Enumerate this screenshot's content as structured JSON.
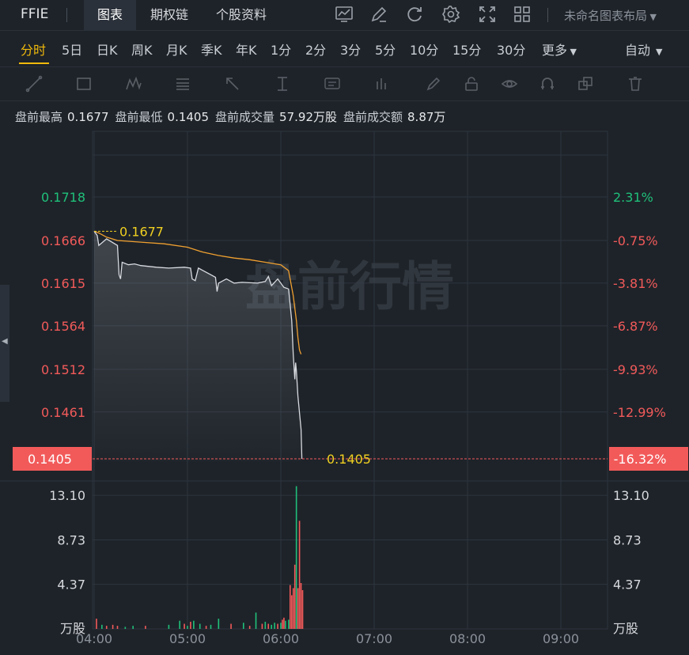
{
  "header": {
    "ticker": "FFIE",
    "tabs": [
      {
        "label": "图表",
        "active": true
      },
      {
        "label": "期权链",
        "active": false
      },
      {
        "label": "个股资料",
        "active": false
      }
    ],
    "toolbar_icons": [
      "chart-type-icon",
      "draw-pen-icon",
      "refresh-icon",
      "settings-gear-icon",
      "fullscreen-icon",
      "layout-grid-icon"
    ],
    "layout_name": "未命名图表布局"
  },
  "periods": {
    "items": [
      "分时",
      "5日",
      "日K",
      "周K",
      "月K",
      "季K",
      "年K",
      "1分",
      "2分",
      "3分",
      "5分",
      "10分",
      "15分",
      "30分",
      "更多"
    ],
    "active": "分时",
    "right_mode": "自动"
  },
  "drawing_tools": [
    "trend-line-icon",
    "rectangle-icon",
    "pattern-icon",
    "fibonacci-icon",
    "arrow-icon",
    "measure-icon",
    "text-note-icon",
    "indicator-icon",
    "brush-icon",
    "lock-icon",
    "eye-icon",
    "magnet-icon",
    "clone-icon",
    "trash-icon"
  ],
  "info": {
    "high_label": "盘前最高",
    "high_value": "0.1677",
    "low_label": "盘前最低",
    "low_value": "0.1405",
    "volume_label": "盘前成交量",
    "volume_value": "57.92万股",
    "amount_label": "盘前成交额",
    "amount_value": "8.87万"
  },
  "watermark": "盘前行情",
  "colors": {
    "up": "#1fc07a",
    "down": "#f25a5a",
    "price_line": "#d8dbe0",
    "avg_line": "#f0a030",
    "highlight": "#f0d020",
    "current_bg": "#f25a5a"
  },
  "chart_data": {
    "type": "line",
    "price_axis": {
      "ticks": [
        "0.1718",
        "0.1666",
        "0.1615",
        "0.1564",
        "0.1512",
        "0.1461"
      ],
      "tick_colors": [
        "up",
        "down",
        "down",
        "down",
        "down",
        "down"
      ],
      "range": [
        0.1405,
        0.1718
      ]
    },
    "percent_axis": {
      "ticks": [
        "2.31%",
        "-0.75%",
        "-3.81%",
        "-6.87%",
        "-9.93%",
        "-12.99%"
      ]
    },
    "current": {
      "price": "0.1405",
      "percent": "-16.32%"
    },
    "high_marker": "0.1677",
    "x_ticks": [
      "04:00",
      "05:00",
      "06:00",
      "07:00",
      "08:00",
      "09:00"
    ],
    "price": [
      [
        0,
        0.1677
      ],
      [
        2,
        0.1672
      ],
      [
        3,
        0.166
      ],
      [
        8,
        0.1668
      ],
      [
        15,
        0.166
      ],
      [
        16,
        0.1625
      ],
      [
        17,
        0.162
      ],
      [
        18,
        0.164
      ],
      [
        22,
        0.1637
      ],
      [
        26,
        0.1638
      ],
      [
        30,
        0.1636
      ],
      [
        40,
        0.1634
      ],
      [
        48,
        0.1633
      ],
      [
        58,
        0.1634
      ],
      [
        62,
        0.1633
      ],
      [
        63,
        0.162
      ],
      [
        65,
        0.1618
      ],
      [
        67,
        0.1633
      ],
      [
        75,
        0.1625
      ],
      [
        78,
        0.1622
      ],
      [
        79,
        0.1605
      ],
      [
        80,
        0.1615
      ],
      [
        85,
        0.162
      ],
      [
        90,
        0.1615
      ],
      [
        95,
        0.1616
      ],
      [
        105,
        0.1615
      ],
      [
        110,
        0.1617
      ],
      [
        112,
        0.1623
      ],
      [
        114,
        0.1612
      ],
      [
        118,
        0.162
      ],
      [
        122,
        0.161
      ],
      [
        125,
        0.1608
      ],
      [
        127,
        0.157
      ],
      [
        128,
        0.153
      ],
      [
        129,
        0.15
      ],
      [
        129.5,
        0.152
      ],
      [
        130,
        0.151
      ],
      [
        131,
        0.148
      ],
      [
        132,
        0.146
      ],
      [
        133,
        0.144
      ],
      [
        133.5,
        0.1405
      ]
    ],
    "average": [
      [
        0,
        0.1677
      ],
      [
        3,
        0.1675
      ],
      [
        8,
        0.167
      ],
      [
        15,
        0.1666
      ],
      [
        30,
        0.1664
      ],
      [
        45,
        0.1662
      ],
      [
        60,
        0.1658
      ],
      [
        70,
        0.1652
      ],
      [
        80,
        0.1648
      ],
      [
        90,
        0.1645
      ],
      [
        100,
        0.1643
      ],
      [
        110,
        0.164
      ],
      [
        120,
        0.1637
      ],
      [
        125,
        0.163
      ],
      [
        128,
        0.16
      ],
      [
        130,
        0.157
      ],
      [
        131,
        0.155
      ],
      [
        132,
        0.1535
      ],
      [
        133,
        0.153
      ]
    ],
    "volume": {
      "unit": "万股",
      "ticks": [
        "13.10",
        "8.73",
        "4.37"
      ],
      "max": 17.46,
      "bars": [
        [
          1.5,
          1.0,
          "down"
        ],
        [
          5,
          0.4,
          "up"
        ],
        [
          8,
          0.3,
          "down"
        ],
        [
          12,
          0.4,
          "down"
        ],
        [
          15,
          0.3,
          "down"
        ],
        [
          20,
          0.2,
          "up"
        ],
        [
          25,
          0.3,
          "up"
        ],
        [
          33,
          0.3,
          "down"
        ],
        [
          48,
          0.4,
          "up"
        ],
        [
          55,
          0.8,
          "up"
        ],
        [
          58,
          0.5,
          "down"
        ],
        [
          60,
          0.3,
          "up"
        ],
        [
          62,
          0.7,
          "down"
        ],
        [
          64,
          0.8,
          "up"
        ],
        [
          68,
          0.5,
          "up"
        ],
        [
          72,
          0.3,
          "down"
        ],
        [
          75,
          0.4,
          "up"
        ],
        [
          80,
          1.0,
          "up"
        ],
        [
          88,
          0.5,
          "down"
        ],
        [
          96,
          0.6,
          "up"
        ],
        [
          100,
          0.3,
          "down"
        ],
        [
          104,
          1.6,
          "up"
        ],
        [
          108,
          0.5,
          "down"
        ],
        [
          110,
          0.7,
          "up"
        ],
        [
          112,
          0.5,
          "down"
        ],
        [
          114,
          0.4,
          "up"
        ],
        [
          116,
          0.6,
          "up"
        ],
        [
          118,
          0.5,
          "down"
        ],
        [
          120,
          0.6,
          "up"
        ],
        [
          121,
          0.9,
          "down"
        ],
        [
          122,
          1.1,
          "down"
        ],
        [
          123,
          0.8,
          "up"
        ],
        [
          125,
          0.9,
          "up"
        ],
        [
          126,
          4.3,
          "down"
        ],
        [
          127,
          3.3,
          "down"
        ],
        [
          128,
          4.0,
          "down"
        ],
        [
          129,
          6.3,
          "down"
        ],
        [
          130,
          14.0,
          "up"
        ],
        [
          131,
          4.0,
          "down"
        ],
        [
          132,
          10.6,
          "down"
        ],
        [
          133,
          4.5,
          "down"
        ],
        [
          134,
          3.8,
          "down"
        ]
      ]
    }
  }
}
